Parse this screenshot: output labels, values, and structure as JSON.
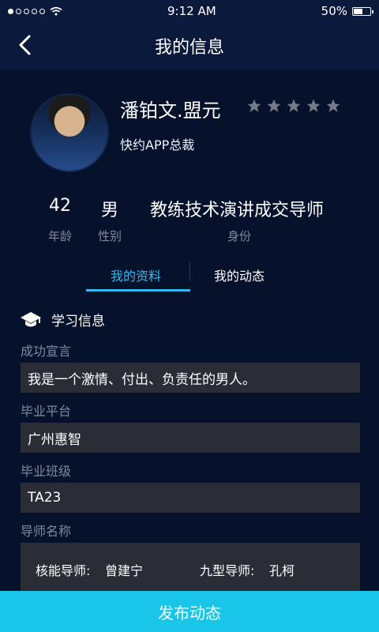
{
  "status_bar": {
    "time": "9:12 AM",
    "battery_percent": "50%",
    "battery_level": 0.5
  },
  "header": {
    "title": "我的信息",
    "back_icon": "chevron-left-icon"
  },
  "profile": {
    "name": "潘铂文.盟元",
    "title": "快约APP总裁",
    "rating_stars": 5,
    "rating_filled": 0
  },
  "stats": [
    {
      "value": "42",
      "label": "年龄"
    },
    {
      "value": "男",
      "label": "性别"
    },
    {
      "value": "教练技术演讲成交导师",
      "label": "身份"
    }
  ],
  "tabs": [
    {
      "label": "我的资料",
      "active": true
    },
    {
      "label": "我的动态",
      "active": false
    }
  ],
  "study": {
    "header": "学习信息",
    "fields": [
      {
        "label": "成功宣言",
        "value": "我是一个激情、付出、负责任的男人。"
      },
      {
        "label": "毕业平台",
        "value": "广州惠智"
      },
      {
        "label": "毕业班级",
        "value": "TA23"
      },
      {
        "label": "导师名称",
        "value": ""
      }
    ],
    "mentors": [
      {
        "label": "核能导师:",
        "name": "曾建宁"
      },
      {
        "label": "九型导师:",
        "name": "孔柯"
      }
    ]
  },
  "bottom_button": "发布动态",
  "colors": {
    "background": "#06112b",
    "header": "#0b1a3c",
    "accent": "#32b8ee",
    "button": "#1ac5ea",
    "field": "#2a2d35"
  }
}
